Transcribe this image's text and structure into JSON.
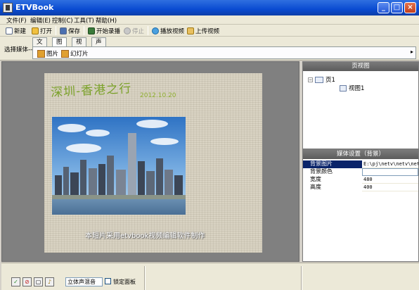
{
  "window": {
    "title": "ETVBook",
    "min": "_",
    "max": "□",
    "close": "×"
  },
  "menu": [
    {
      "label": "文件(F)"
    },
    {
      "label": "编辑(E)"
    },
    {
      "label": "控制(C)"
    },
    {
      "label": "工具(T)"
    },
    {
      "label": "帮助(H)"
    }
  ],
  "toolbar": {
    "new": "新建",
    "open": "打开",
    "save": "保存",
    "record": "开始录播",
    "stop": "停止",
    "play": "播放视频",
    "upload": "上传视频"
  },
  "media_select": {
    "label": "选择媒体-->",
    "tabs": [
      "文字",
      "图形",
      "视频",
      "声音"
    ],
    "active_tab": "图形",
    "items": [
      "图片",
      "幻灯片"
    ]
  },
  "slide": {
    "title": "深圳-香港之行",
    "date": "2012.10.20",
    "caption": "本短片采用etvbook视频编辑软件制作"
  },
  "page_view": {
    "header": "页视图",
    "tree": {
      "page": "页1",
      "view": "视图1",
      "toggle": "−"
    }
  },
  "media_settings": {
    "header": "媒体设置（背景）",
    "rows": [
      {
        "key": "背景图片",
        "value": "E:\\pj\\netv\\netv\\net"
      },
      {
        "key": "背景颜色",
        "value": ""
      },
      {
        "key": "宽度",
        "value": "480"
      },
      {
        "key": "高度",
        "value": "400"
      }
    ]
  },
  "bottom": {
    "mix": "立体声混音",
    "lock": "锁定面板"
  }
}
